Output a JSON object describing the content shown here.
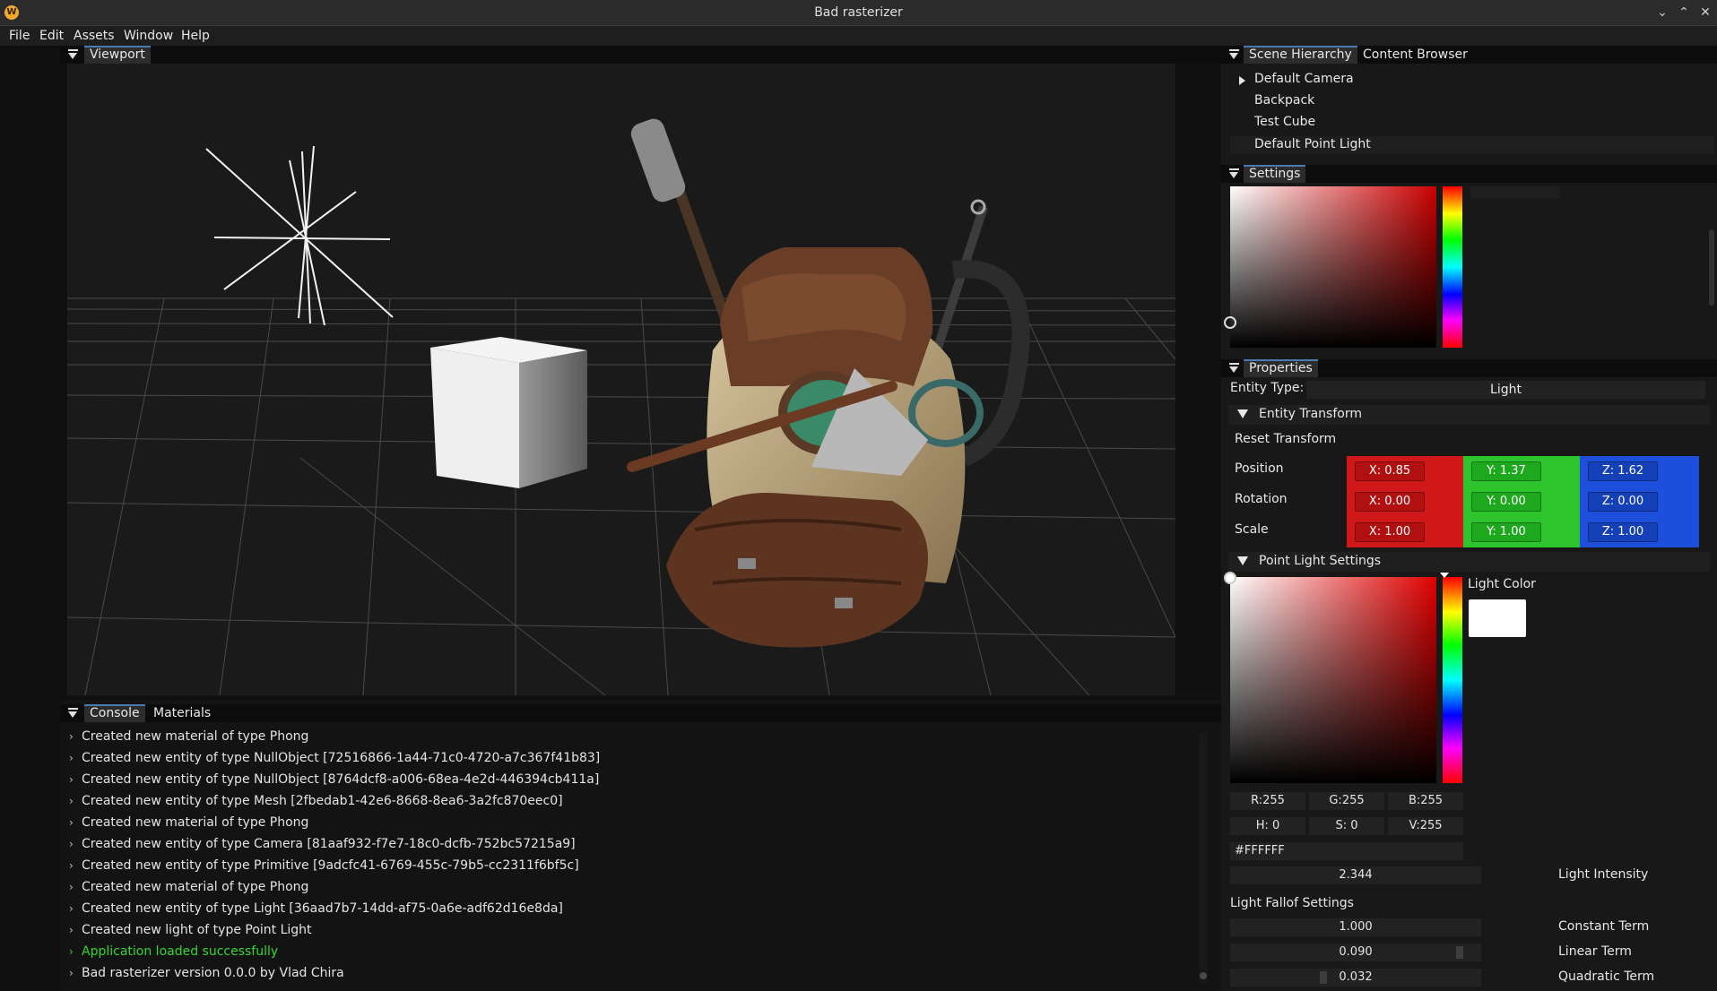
{
  "window": {
    "title": "Bad rasterizer",
    "icon_letter": "W"
  },
  "menu": [
    "File",
    "Edit",
    "Assets",
    "Window",
    "Help"
  ],
  "viewport": {
    "tab": "Viewport"
  },
  "console": {
    "tabs": [
      "Console",
      "Materials"
    ],
    "logs": [
      {
        "text": "Created new material of type Phong",
        "type": "info"
      },
      {
        "text": "Created new entity of type NullObject  [72516866-1a44-71c0-4720-a7c367f41b83]",
        "type": "info"
      },
      {
        "text": "Created new entity of type NullObject  [8764dcf8-a006-68ea-4e2d-446394cb411a]",
        "type": "info"
      },
      {
        "text": "Created new entity of type Mesh  [2fbedab1-42e6-8668-8ea6-3a2fc870eec0]",
        "type": "info"
      },
      {
        "text": "Created new material of type Phong",
        "type": "info"
      },
      {
        "text": "Created new entity of type Camera  [81aaf932-f7e7-18c0-dcfb-752bc57215a9]",
        "type": "info"
      },
      {
        "text": "Created new entity of type Primitive  [9adcfc41-6769-455c-79b5-cc2311f6bf5c]",
        "type": "info"
      },
      {
        "text": "Created new material of type Phong",
        "type": "info"
      },
      {
        "text": "Created new entity of type Light  [36aad7b7-14dd-af75-0a6e-adf62d16e8da]",
        "type": "info"
      },
      {
        "text": "Created new light of type Point Light",
        "type": "info"
      },
      {
        "text": "Application loaded successfully",
        "type": "success"
      },
      {
        "text": "Bad rasterizer version 0.0.0 by Vlad Chira",
        "type": "info"
      }
    ]
  },
  "hierarchy": {
    "tabs": [
      "Scene Hierarchy",
      "Content Browser"
    ],
    "items": [
      "Default Camera",
      "Backpack",
      "Test Cube",
      "Default Point Light"
    ],
    "selected": "Default Point Light"
  },
  "settings": {
    "tab": "Settings"
  },
  "properties": {
    "tab": "Properties",
    "entity_type_label": "Entity Type:",
    "entity_type": "Light",
    "transform_section": "Entity Transform",
    "reset_label": "Reset Transform",
    "rows": [
      {
        "label": "Position",
        "x": "X: 0.85",
        "y": "Y: 1.37",
        "z": "Z: 1.62"
      },
      {
        "label": "Rotation",
        "x": "X: 0.00",
        "y": "Y: 0.00",
        "z": "Z: 0.00"
      },
      {
        "label": "Scale",
        "x": "X: 1.00",
        "y": "Y: 1.00",
        "z": "Z: 1.00"
      }
    ],
    "colors": {
      "x": "#d01818",
      "y": "#2ec42e",
      "z": "#1e4fdc"
    },
    "point_light_section": "Point Light Settings",
    "light_color_label": "Light Color",
    "light_color": "#FFFFFF",
    "rgb": {
      "r": "R:255",
      "g": "G:255",
      "b": "B:255"
    },
    "hsv": {
      "h": "H:  0",
      "s": "S:  0",
      "v": "V:255"
    },
    "hex": "#FFFFFF",
    "intensity": {
      "value": "2.344",
      "label": "Light Intensity"
    },
    "falloff_title": "Light Fallof Settings",
    "falloff": [
      {
        "value": "1.000",
        "label": "Constant Term",
        "fraction": 0.5
      },
      {
        "value": "0.090",
        "label": "Linear Term",
        "fraction": 0.9
      },
      {
        "value": "0.032",
        "label": "Quadratic Term",
        "fraction": 0.3
      }
    ]
  }
}
